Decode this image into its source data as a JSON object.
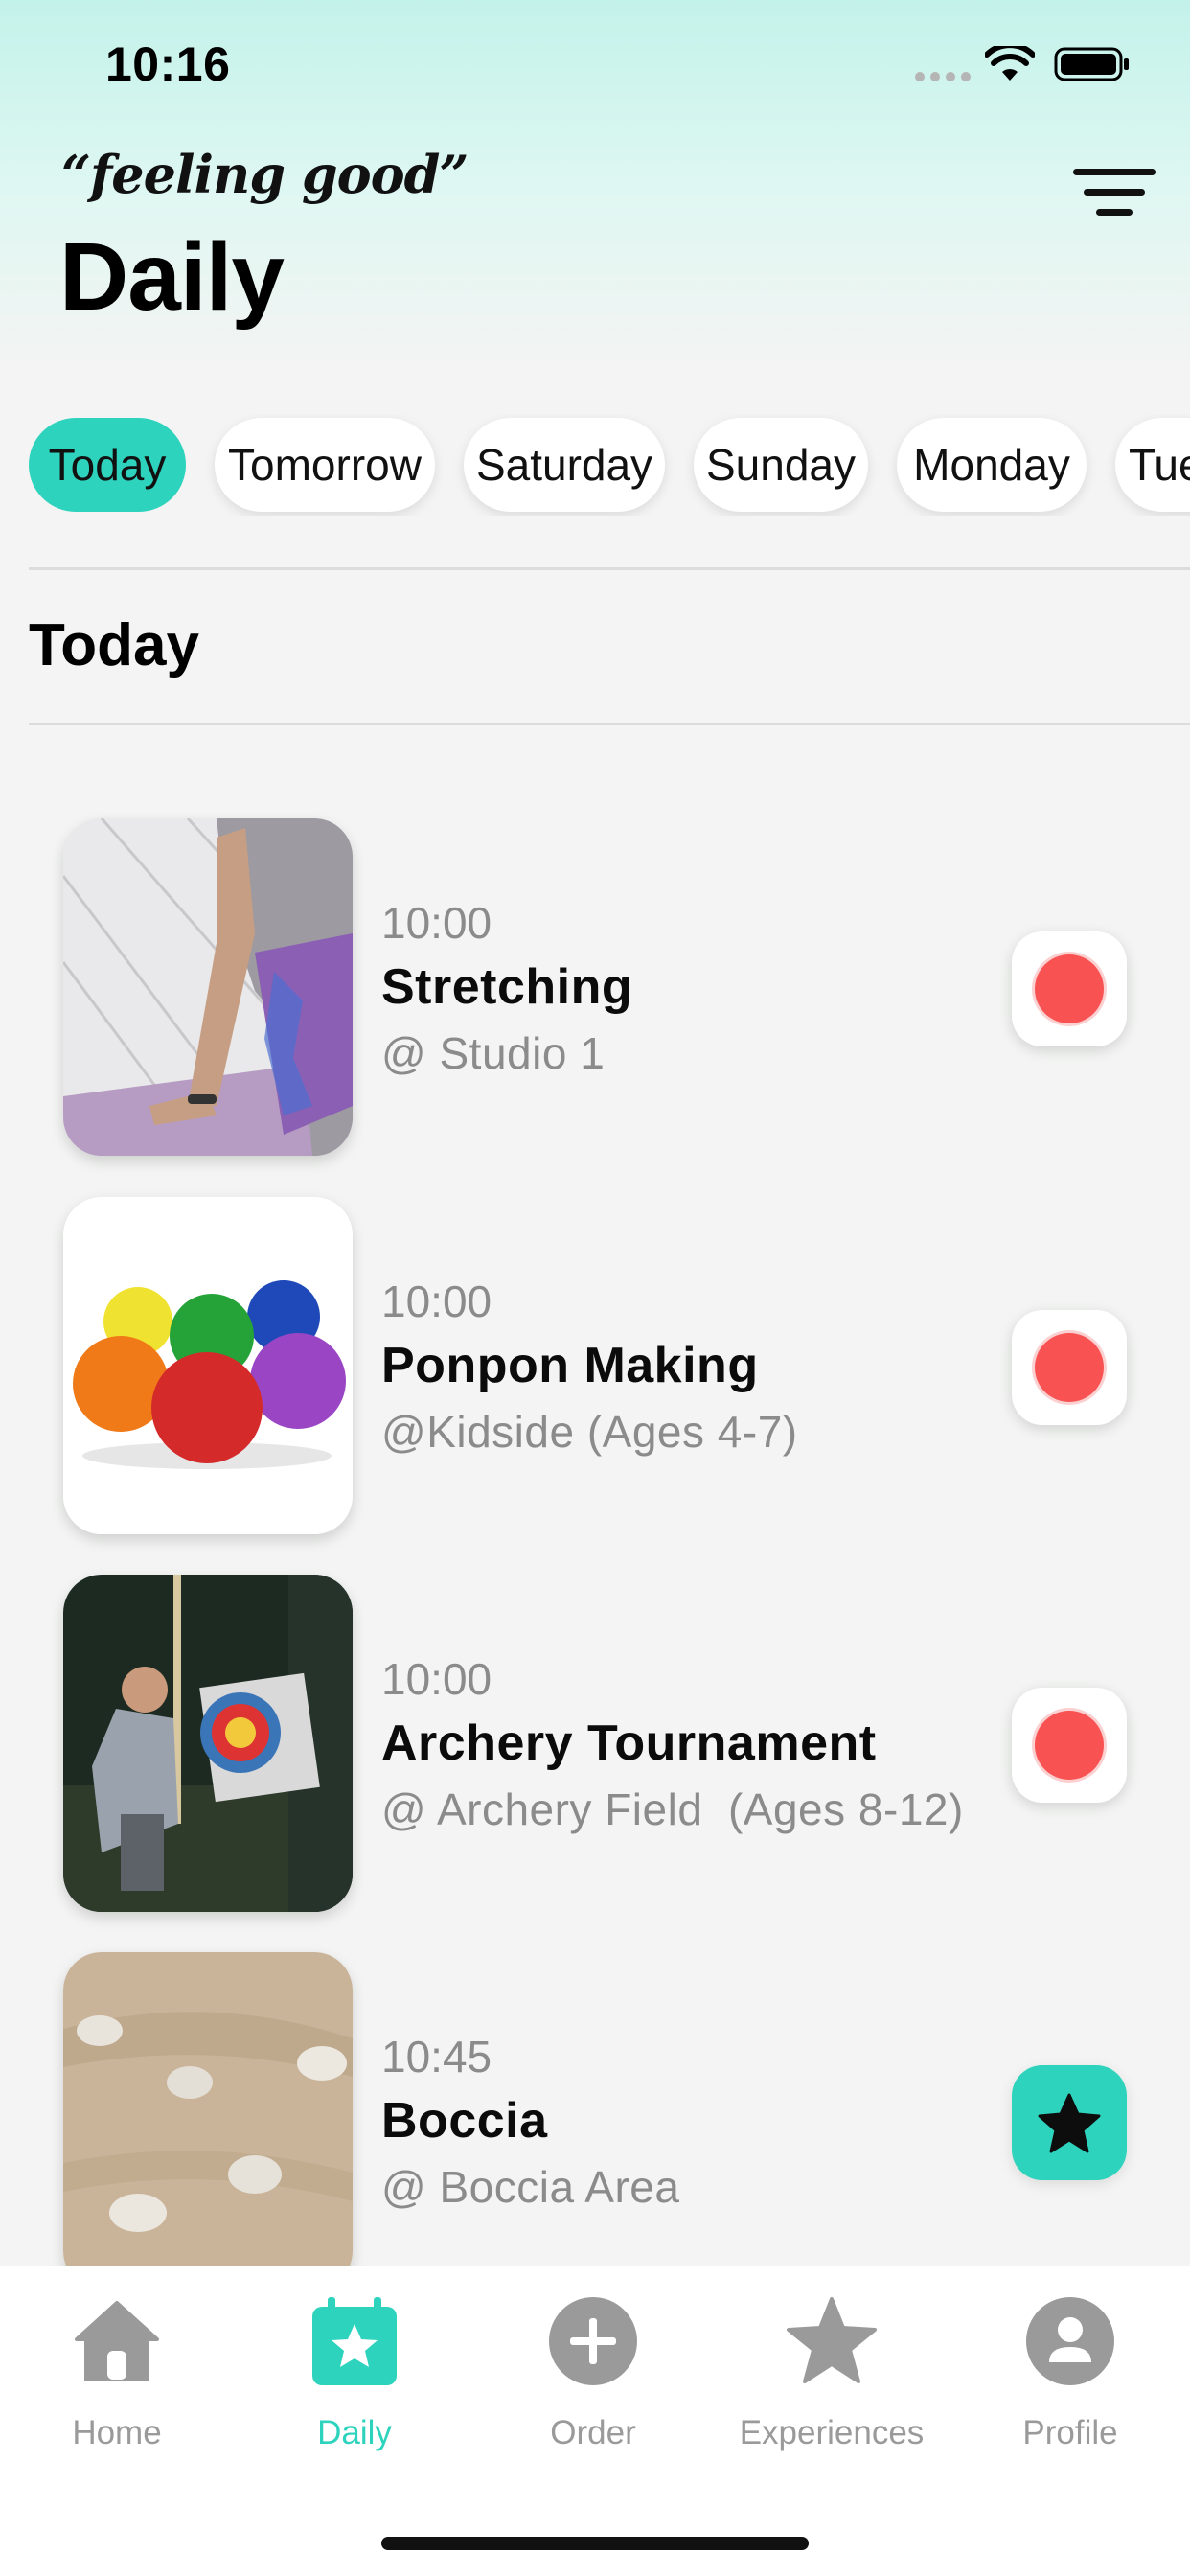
{
  "status_bar": {
    "time": "10:16"
  },
  "header": {
    "brand": "“feeling good”",
    "title": "Daily",
    "filter_icon": "filter-icon"
  },
  "day_tabs": [
    "Today",
    "Tomorrow",
    "Saturday",
    "Sunday",
    "Monday",
    "Tuesday"
  ],
  "selected_day": "Today",
  "section_title": "Today",
  "activities": [
    {
      "time": "10:00",
      "title": "Stretching",
      "location": "@ Studio 1",
      "action": "record-dot"
    },
    {
      "time": "10:00",
      "title": "Ponpon Making",
      "location": "@Kidside (Ages 4-7)",
      "action": "record-dot"
    },
    {
      "time": "10:00",
      "title": "Archery Tournament",
      "location": "@ Archery Field  (Ages 8-12)",
      "action": "record-dot"
    },
    {
      "time": "10:45",
      "title": "Boccia",
      "location": "@ Boccia Area",
      "action": "star-icon"
    }
  ],
  "tab_bar": {
    "items": [
      {
        "label": "Home",
        "icon": "home-icon"
      },
      {
        "label": "Daily",
        "icon": "daily-calendar-icon"
      },
      {
        "label": "Order",
        "icon": "plus-icon"
      },
      {
        "label": "Experiences",
        "icon": "star-icon"
      },
      {
        "label": "Profile",
        "icon": "profile-icon"
      }
    ],
    "active": "Daily"
  },
  "colors": {
    "accent": "#2ed3bd",
    "record": "#f85252",
    "inactive": "#9a9a9a"
  }
}
